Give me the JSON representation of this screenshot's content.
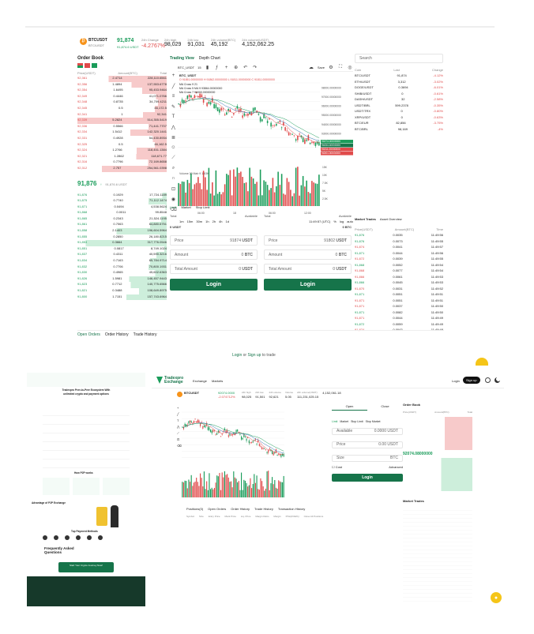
{
  "header": {
    "pair": "BTCUSDT",
    "pair_sub": "BTC/USDT",
    "price": "91,874",
    "price_sub": "91,874.6 USDT",
    "change_label": "24h Change",
    "change": "-4.2767%",
    "stats": [
      {
        "label": "24h high",
        "value": "98,029"
      },
      {
        "label": "24h low",
        "value": "91,031"
      },
      {
        "label": "24h volume(BTC)",
        "value": "45,192"
      },
      {
        "label": "24h volume(USDT)",
        "value": "4,152,062.25"
      }
    ]
  },
  "orderbook": {
    "title": "Order Book",
    "headers": [
      "Price(USDT)",
      "Amount(BTC)",
      "Total"
    ],
    "asks": [
      [
        "92,361",
        "2.4714",
        "228,110.6561"
      ],
      [
        "92,356",
        "1.4894",
        "137,553.6778"
      ],
      [
        "92,354",
        "1.6495",
        "95,453.9464"
      ],
      [
        "92,349",
        "0.4446",
        "41,071.0766"
      ],
      [
        "92,348",
        "0.8735",
        "34,709.4211"
      ],
      [
        "92,345",
        "0.5",
        "46,172.5"
      ],
      [
        "92,341",
        "1",
        "92,341"
      ],
      [
        "92,339",
        "5.2824",
        "514,355.5419"
      ],
      [
        "92,336",
        "0.5566",
        "71,441.7707"
      ],
      [
        "92,334",
        "1.5412",
        "142,320.1441"
      ],
      [
        "92,331",
        "0.4928",
        "54,430.8934"
      ],
      [
        "92,325",
        "0.5",
        "46,162.5"
      ],
      [
        "92,324",
        "1.2766",
        "118,451.1384"
      ],
      [
        "92,321",
        "1.2862",
        "118,671.77"
      ],
      [
        "92,316",
        "0.7796",
        "72,169.8658"
      ],
      [
        "92,312",
        "2.757",
        "254,561.0398"
      ]
    ],
    "mid_price": "91,876",
    "mid_sub": "91,876.6 USDT",
    "bids": [
      [
        "91,876",
        "0.1929",
        "17,724.1189"
      ],
      [
        "91,875",
        "0.7740",
        "71,112.1474"
      ],
      [
        "91,871",
        "0.0494",
        "4,538.5624"
      ],
      [
        "91,868",
        "0.0011",
        "99.8548"
      ],
      [
        "91,865",
        "0.2343",
        "21,524.1195"
      ],
      [
        "91,861",
        "0.7063",
        "64,880.6751"
      ],
      [
        "91,858",
        "2.1403",
        "196,604.5964"
      ],
      [
        "91,855",
        "0.2850",
        "26,180.8215"
      ],
      [
        "91,853",
        "0.3664",
        "317,776.0546"
      ],
      [
        "91,851",
        "0.0817",
        "8,749.1024"
      ],
      [
        "91,837",
        "0.4311",
        "40,590.3216"
      ],
      [
        "91,834",
        "0.7163",
        "65,784.9714"
      ],
      [
        "91,832",
        "0.7706",
        "70,800.1931"
      ],
      [
        "91,830",
        "0.4965",
        "45,602.6363"
      ],
      [
        "91,826",
        "1.5981",
        "146,457.9443"
      ],
      [
        "91,823",
        "0.7712",
        "140,775.6566"
      ],
      [
        "91,821",
        "0.3488",
        "108,649.8975"
      ],
      [
        "91,800",
        "1.7151",
        "157,743.6964"
      ]
    ]
  },
  "chart": {
    "tabs": [
      "Trading View",
      "Depth Chart"
    ],
    "symbol": "BTC_USDT",
    "interval": "15",
    "ohlc": "O 91851.00000000  H 91862.00000000  L 91811.00000000  C 91811.00000000",
    "ma_lines": [
      "MA Cross 9 21",
      "MA Cross 5 MA 9 93864.00000000",
      "MA Cross 7 96000.00000000"
    ],
    "volume_label": "Volume 20 Mab 9  1.63K",
    "save_label": "Save",
    "price_scale": [
      "98000.00000000",
      "97000.00000000",
      "96000.00000000",
      "95000.00000000",
      "94000.00000000",
      "93000.00000000",
      "92000.00000000",
      "91000.00000000"
    ],
    "price_tags": [
      "91874.00000000",
      "91834.40000000",
      "91811.00000000",
      "91801.00000000"
    ],
    "vol_scale": [
      "15K",
      "10K",
      "7.5K",
      "5K",
      "2.5K"
    ],
    "time_labels": [
      "06:00",
      "18",
      "06:00",
      "12:00"
    ],
    "time_ranges": [
      "1m",
      "15m",
      "30m",
      "1h",
      "2h",
      "4h",
      "1d"
    ],
    "clock": "11:49:57 (UTC)",
    "scale_opts": [
      "%",
      "log",
      "auto"
    ],
    "chart_data": {
      "type": "candlestick",
      "ylim": [
        90500,
        98500
      ],
      "trend": [
        96200,
        96500,
        96800,
        97100,
        96900,
        97300,
        97000,
        96600,
        96300,
        96500,
        96000,
        95600,
        95800,
        95300,
        95500,
        95100,
        95700,
        95400,
        95000,
        94800,
        95300,
        95600,
        95200,
        94600,
        94900,
        94300,
        94000,
        93700,
        94200,
        93900,
        93400,
        93100,
        92800,
        92500,
        92700,
        92200,
        92500,
        92100,
        91800,
        91870
      ]
    }
  },
  "trade": {
    "tabs": [
      "Limit",
      "Market",
      "Stop Limit"
    ],
    "left": {
      "total": "Total",
      "available": "Available",
      "balance": "0 USDT",
      "price_label": "Price",
      "price": "91874",
      "price_unit": "USDT",
      "amount_label": "Amount",
      "amount": "0",
      "amount_unit": "BTC",
      "total_amount_label": "Total Amount",
      "total_amount": "0",
      "total_unit": "USDT",
      "login": "Login"
    },
    "right": {
      "total": "Total",
      "available": "Available",
      "balance": "0 BTC",
      "price_label": "Price",
      "price": "91802",
      "price_unit": "USDT",
      "amount_label": "Amount",
      "amount": "0",
      "amount_unit": "BTC",
      "total_amount_label": "Total Amount",
      "total_amount": "0",
      "total_unit": "USDT",
      "login": "Login"
    }
  },
  "market": {
    "search_placeholder": "Search",
    "headers": [
      "Coin",
      "Last",
      "Change"
    ],
    "rows": [
      [
        "BTC/USDT",
        "91,874",
        "-4.12%"
      ],
      [
        "ETH/USDT",
        "3,312",
        "-3.02%"
      ],
      [
        "DOGE/USDT",
        "0.3694",
        "-6.01%"
      ],
      [
        "SHIB/USDT",
        "0",
        "-0.61%"
      ],
      [
        "DASH/USDT",
        "32",
        "-2.58%"
      ],
      [
        "USDT/BRL",
        "599.2378",
        "-0.35%"
      ],
      [
        "USDT/TRX",
        "0",
        "-0.80%"
      ],
      [
        "XRP/USDT",
        "0",
        "-0.63%"
      ],
      [
        "BTC/EUR",
        "82,856",
        "-3.75%"
      ],
      [
        "BTC/BRL",
        "98,169",
        "-4%"
      ]
    ]
  },
  "trades": {
    "tabs": [
      "Market Trades",
      "Asset Overview"
    ],
    "headers": [
      "Price(USDT)",
      "Amount(BTC)",
      "Time"
    ],
    "rows": [
      [
        "91,876",
        "0.0035",
        "11:49:56",
        "g"
      ],
      [
        "91,876",
        "0.0073",
        "11:49:55",
        "g"
      ],
      [
        "91,874",
        "0.0041",
        "11:49:57",
        "r"
      ],
      [
        "91,871",
        "0.0044",
        "11:49:56",
        "g"
      ],
      [
        "91,872",
        "0.0039",
        "11:49:55",
        "r"
      ],
      [
        "91,868",
        "0.0052",
        "11:49:54",
        "g"
      ],
      [
        "91,868",
        "0.0077",
        "11:49:54",
        "r"
      ],
      [
        "91,866",
        "0.0061",
        "11:49:53",
        "r"
      ],
      [
        "91,866",
        "0.0045",
        "11:49:53",
        "g"
      ],
      [
        "91,870",
        "0.0031",
        "11:49:52",
        "r"
      ],
      [
        "91,871",
        "0.0051",
        "11:49:51",
        "g"
      ],
      [
        "91,871",
        "0.0051",
        "11:49:51",
        "r"
      ],
      [
        "91,871",
        "0.0037",
        "11:49:50",
        "r"
      ],
      [
        "91,871",
        "0.0082",
        "11:49:50",
        "g"
      ],
      [
        "91,871",
        "0.0044",
        "11:49:49",
        "r"
      ],
      [
        "91,872",
        "0.0059",
        "11:49:49",
        "g"
      ],
      [
        "91,874",
        "0.0043",
        "11:49:48",
        "r"
      ]
    ]
  },
  "bottom": {
    "tabs": [
      "Open Orders",
      "Order History",
      "Trade History"
    ],
    "login": "Login",
    "or": "or",
    "signup": "Sign up",
    "to_trade": "to trade"
  },
  "site": {
    "brand": "Tradexpro Exchange",
    "nav": [
      "Exchange",
      "Markets"
    ],
    "login": "Login",
    "signup": "Sign up",
    "hero": "Tradexpro Peer-to-Peer Ecosystem With unlimited crypto and payment options",
    "how": "How P2P works",
    "advantages": "Advantage of P2P Exchange",
    "payments": "Top Payment Methods",
    "faq": "Frequently Asked Questions",
    "cta": "Start Your Crypto Journey Now!"
  },
  "mini": {
    "pair": "BTCUSDT",
    "price": "92074.0000",
    "change": "-2.074712%",
    "stats": [
      [
        "24h high",
        "98,025"
      ],
      [
        "24h low",
        "91,501"
      ],
      [
        "24h volume",
        "92,621"
      ],
      [
        "Volume",
        "5.05"
      ],
      [
        "24h volume(USDT)",
        "111,231,025.15"
      ],
      [
        "",
        "4,152,061.18"
      ]
    ],
    "order_tabs": [
      "Open",
      "Close"
    ],
    "trade_tabs": [
      "Limit",
      "Market",
      "Stop Limit",
      "Stop Market"
    ],
    "available": "Available",
    "available_val": "0.0000 USDT",
    "price_label": "Price",
    "price_val": "0.00 USDT",
    "size_label": "Size",
    "size_unit": "BTC",
    "cost_label": "Cost",
    "advanced": "Advanced",
    "login": "Login",
    "orderbook_title": "Order Book",
    "ob_mid": "92074.08000000",
    "bottom_tabs": [
      "Positions(0)",
      "Open Orders",
      "Order History",
      "Trade History",
      "Transaction History"
    ],
    "trade_cols": [
      "Symbol",
      "Size",
      "Entry Price",
      "Mark Price",
      "Liq. Price",
      "Margin Ratio",
      "Margin",
      "PNL(ROE%)",
      "Close All Positions"
    ],
    "market_trades": "Market Trades",
    "ob_headers": [
      "Price(USDT)",
      "Amount(BTC)",
      "Total"
    ]
  }
}
